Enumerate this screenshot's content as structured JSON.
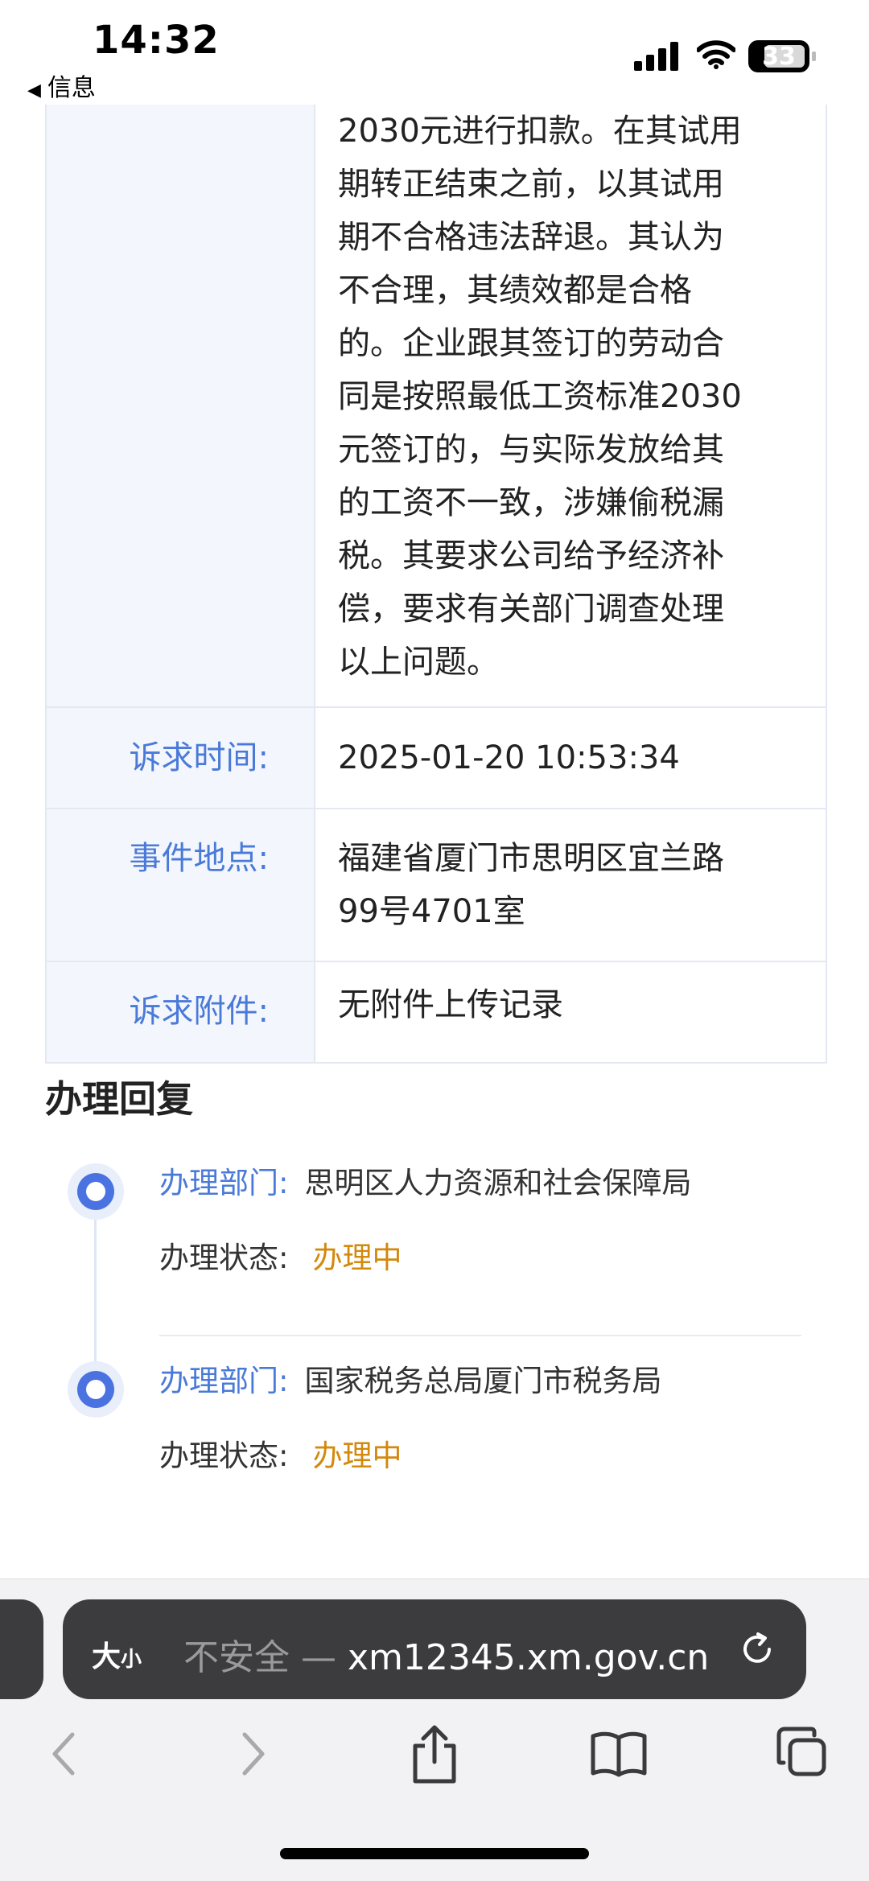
{
  "status_bar": {
    "time": "14:32",
    "back_label": "信息",
    "battery": "33"
  },
  "complaint": {
    "content_lines": [
      "2030元进行扣款。在其试用",
      "期转正结束之前，以其试用",
      "期不合格违法辞退。其认为",
      "不合理，其绩效都是合格",
      "的。企业跟其签订的劳动合",
      "同是按照最低工资标准2030",
      "元签订的，与实际发放给其",
      "的工资不一致，涉嫌偷税漏",
      "税。其要求公司给予经济补",
      "偿，要求有关部门调查处理",
      "以上问题。"
    ],
    "time_label": "诉求时间:",
    "time_value": "2025-01-20 10:53:34",
    "place_label": "事件地点:",
    "place_lines": [
      "福建省厦门市思明区宜兰路",
      "99号4701室"
    ],
    "attach_label": "诉求附件:",
    "attach_value": "无附件上传记录"
  },
  "handling": {
    "title": "办理回复",
    "items": [
      {
        "dept_label": "办理部门:",
        "dept": "思明区人力资源和社会保障局",
        "status_label": "办理状态:",
        "status": "办理中"
      },
      {
        "dept_label": "办理部门:",
        "dept": "国家税务总局厦门市税务局",
        "status_label": "办理状态:",
        "status": "办理中"
      }
    ],
    "status_color": "#d3890c"
  },
  "browser": {
    "text_size_big": "大",
    "text_size_small": "小",
    "insecure": "不安全 —",
    "domain": "xm12345.xm.gov.cn",
    "toolbar_icons": [
      "back-icon",
      "forward-icon",
      "share-icon",
      "bookmarks-icon",
      "tabs-icon"
    ]
  }
}
